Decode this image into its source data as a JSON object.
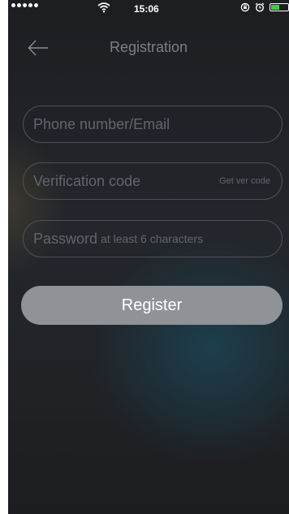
{
  "status_bar": {
    "time": "15:06"
  },
  "nav": {
    "title": "Registration",
    "back_icon": "arrow-left-icon"
  },
  "form": {
    "phone_placeholder": "Phone number/Email",
    "code_placeholder": "Verification code",
    "get_code_label": "Get ver code",
    "password_placeholder_main": "Password",
    "password_placeholder_hint": "at least 6 characters",
    "register_label": "Register"
  },
  "colors": {
    "background": "#202226",
    "button": "#8f9296",
    "field_border": "#4d5056",
    "placeholder": "#62656b",
    "title": "#7c7f85"
  }
}
